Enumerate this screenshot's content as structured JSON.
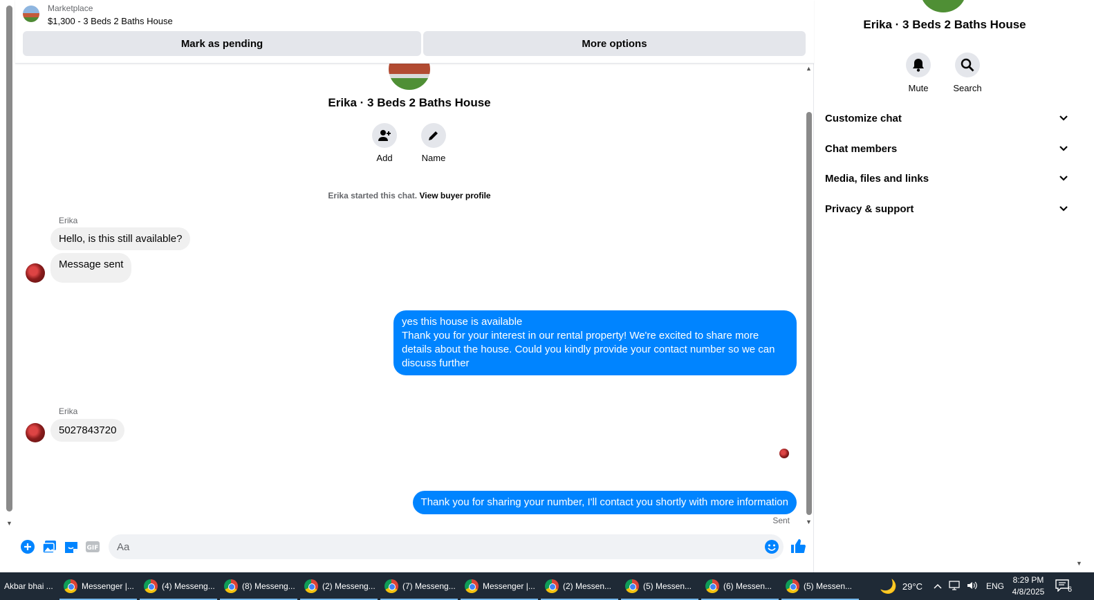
{
  "header": {
    "source": "Marketplace",
    "listing_title": "$1,300 - 3 Beds 2 Baths House",
    "mark_pending_label": "Mark as pending",
    "more_options_label": "More options"
  },
  "conversation": {
    "title": "Erika · 3 Beds 2 Baths House",
    "add_label": "Add",
    "name_label": "Name",
    "started_text": "Erika started this chat.",
    "view_profile_link": "View buyer profile"
  },
  "messages": [
    {
      "sender": "Erika",
      "text": "Hello, is this still available?"
    },
    {
      "sender": "",
      "text": "Message sent"
    },
    {
      "sender": "me",
      "lines": [
        "yes this house is available",
        "Thank you for your interest in our rental property! We're excited to share more",
        "details about the house. Could you kindly provide your contact number so we can",
        "discuss further"
      ]
    },
    {
      "sender": "Erika",
      "text": "5027843720"
    },
    {
      "sender": "me",
      "text": "Thank you for sharing your number, I'll contact you shortly with more information",
      "status": "Sent"
    }
  ],
  "composer": {
    "placeholder": "Aa",
    "icons": [
      "plus-icon",
      "photo-icon",
      "sticker-icon",
      "gif-icon",
      "emoji-icon",
      "like-icon"
    ],
    "gif_label": "GIF"
  },
  "panel": {
    "title": "Erika · 3 Beds 2 Baths House",
    "mute_label": "Mute",
    "search_label": "Search",
    "sections": [
      "Customize chat",
      "Chat members",
      "Media, files and links",
      "Privacy & support"
    ]
  },
  "taskbar": {
    "items": [
      "Akbar bhai ...",
      "Messenger |...",
      "(4) Messeng...",
      "(8) Messeng...",
      "(2) Messeng...",
      "(7) Messeng...",
      "Messenger |...",
      "(2) Messen...",
      "(5) Messen...",
      "(6) Messen...",
      "(5) Messen..."
    ],
    "weather": "29°C",
    "language": "ENG",
    "time": "8:29 PM",
    "date": "4/8/2025",
    "notifications": "6"
  },
  "colors": {
    "accent": "#0084ff",
    "incoming_bubble": "#f0f0f0",
    "button_bg": "#e4e6eb",
    "taskbar": "#1f2a36"
  }
}
